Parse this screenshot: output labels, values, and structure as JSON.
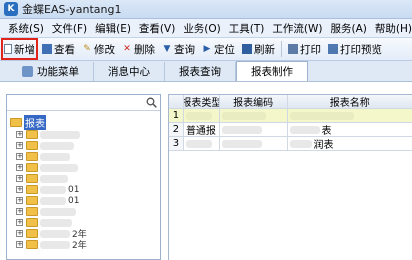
{
  "window": {
    "title": "金蝶EAS-yantang1"
  },
  "menu": [
    "系统(S)",
    "文件(F)",
    "编辑(E)",
    "查看(V)",
    "业务(O)",
    "工具(T)",
    "工作流(W)",
    "服务(A)",
    "帮助(H)"
  ],
  "toolbar": {
    "new": "新增",
    "view": "查看",
    "edit": "修改",
    "delete": "删除",
    "query": "查询",
    "locate": "定位",
    "refresh": "刷新",
    "print": "打印",
    "print_preview": "打印预览"
  },
  "tabs": [
    "功能菜单",
    "消息中心",
    "报表查询",
    "报表制作"
  ],
  "tree": {
    "root": "报表",
    "fragments": [
      "01",
      "01",
      "2年",
      "2年"
    ]
  },
  "grid": {
    "headers": [
      "报表类型",
      "报表编码",
      "报表名称"
    ],
    "rows": [
      {
        "num": "1",
        "type": "",
        "code": "",
        "name": ""
      },
      {
        "num": "2",
        "type": "普通报",
        "code": "",
        "name": "表"
      },
      {
        "num": "3",
        "type": "",
        "code": "",
        "name": "润表"
      }
    ]
  },
  "colors": {
    "highlight": "#e0241b",
    "selection": "#3569c5"
  }
}
